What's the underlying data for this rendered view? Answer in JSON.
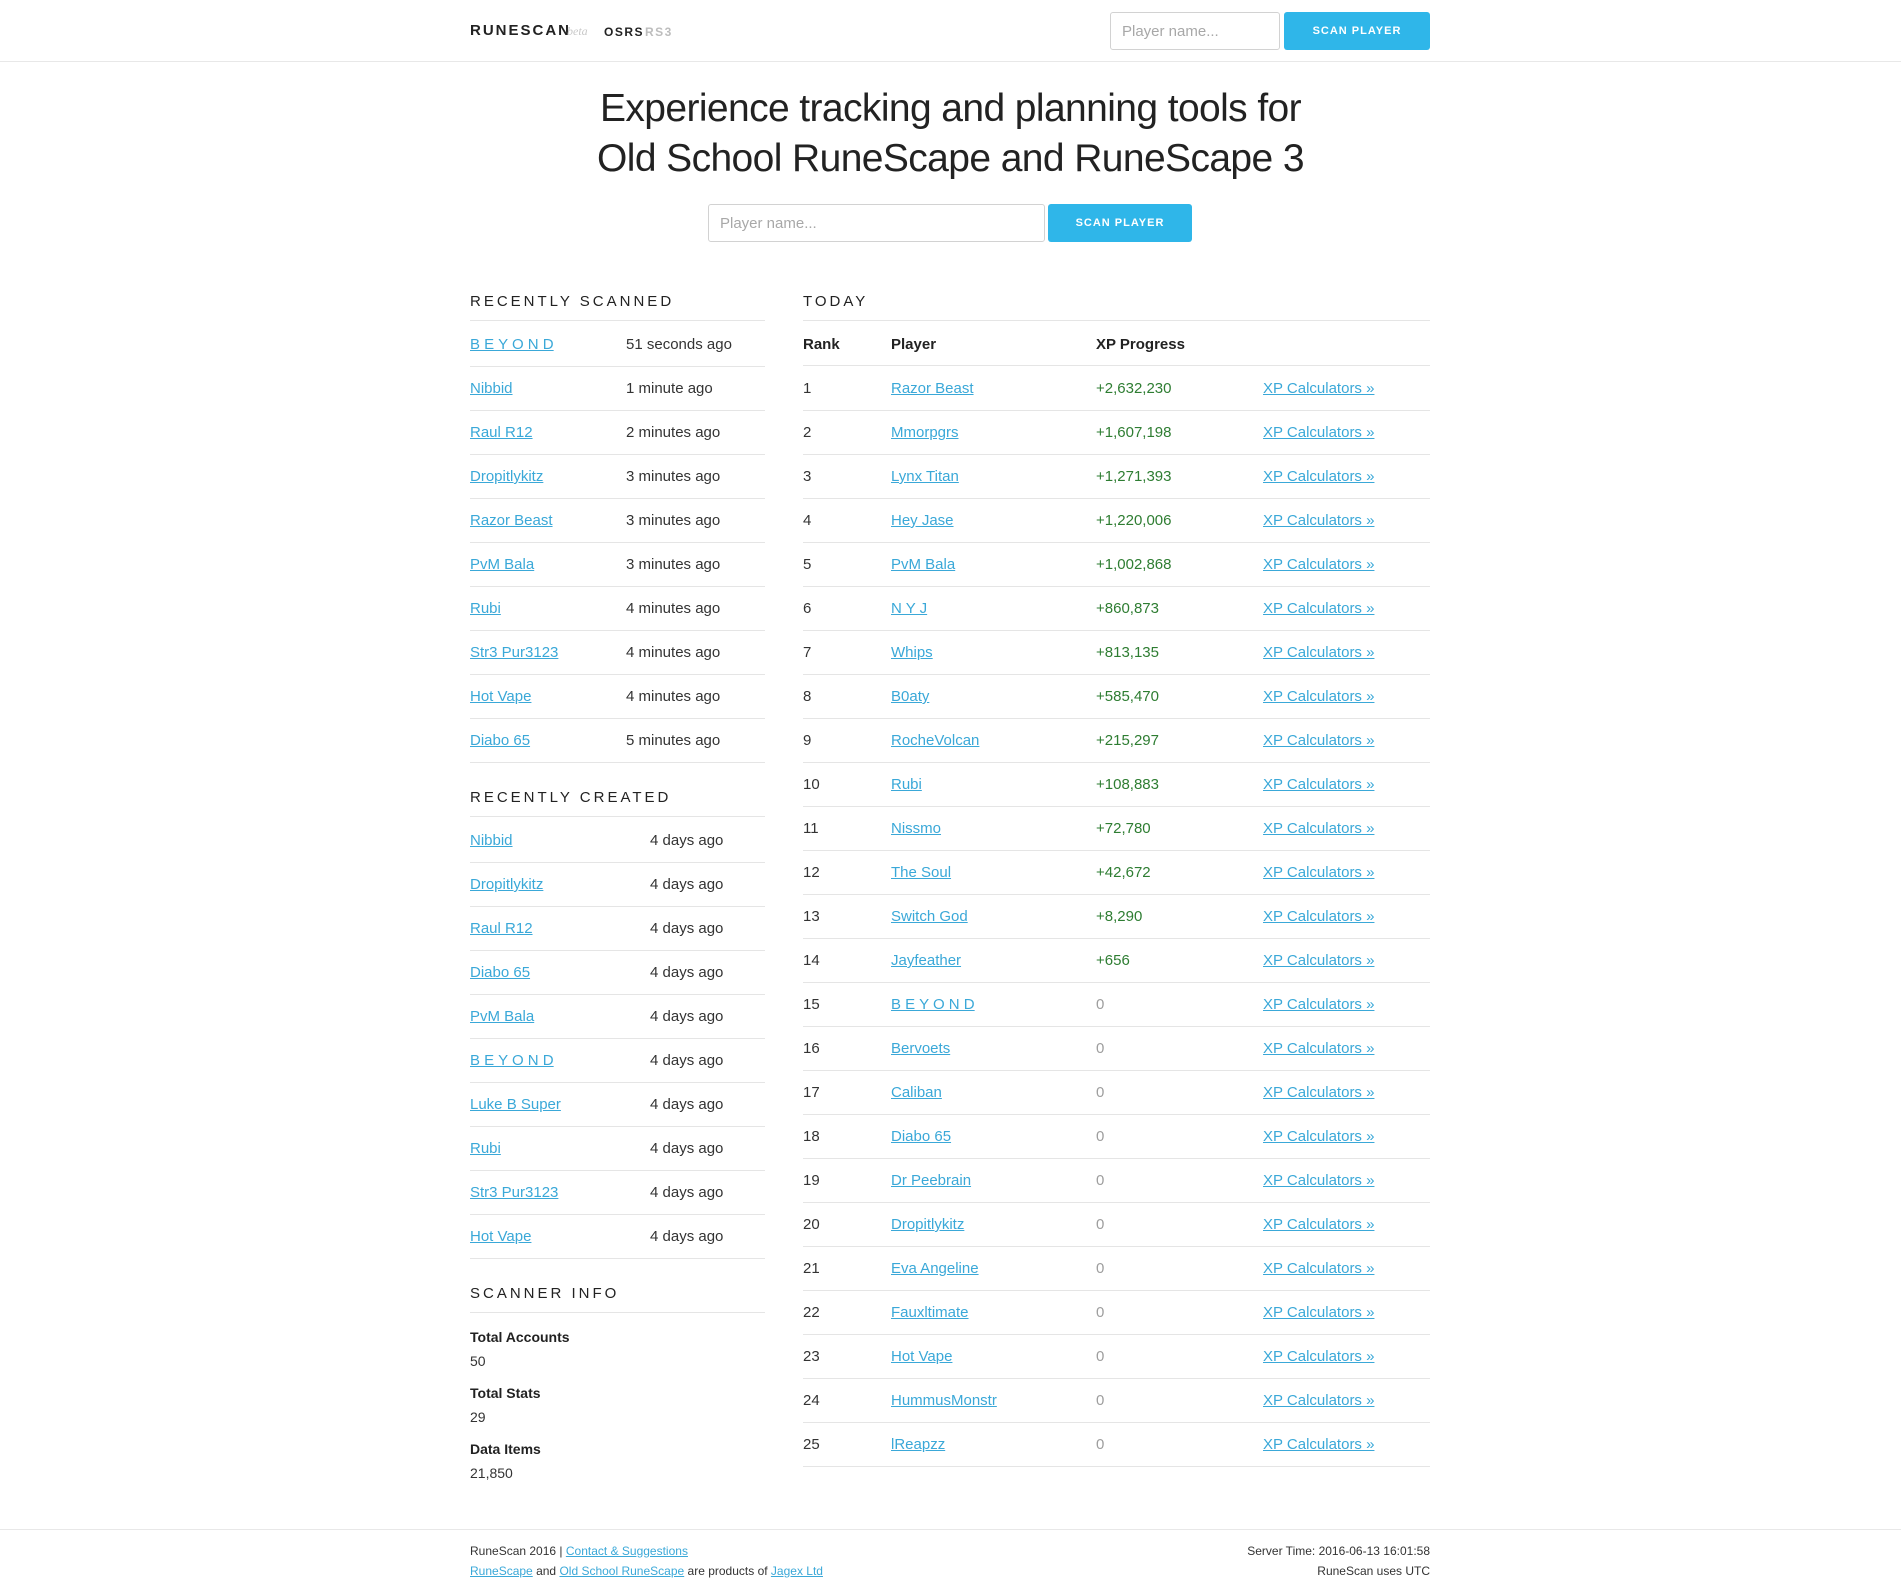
{
  "nav": {
    "brand": "RUNESCAN",
    "beta": "beta",
    "osrs": "OSRS",
    "rs3": "RS3",
    "search_placeholder": "Player name...",
    "scan_button": "SCAN PLAYER"
  },
  "hero": {
    "title_line1": "Experience tracking and planning tools for",
    "title_line2": "Old School RuneScape and RuneScape 3",
    "search_placeholder": "Player name...",
    "scan_button": "SCAN PLAYER"
  },
  "recently_scanned": {
    "heading": "RECENTLY SCANNED",
    "items": [
      {
        "name": "B E Y O N D",
        "time": "51 seconds ago"
      },
      {
        "name": "Nibbid",
        "time": "1 minute ago"
      },
      {
        "name": "Raul R12",
        "time": "2 minutes ago"
      },
      {
        "name": "Dropitlykitz",
        "time": "3 minutes ago"
      },
      {
        "name": "Razor Beast",
        "time": "3 minutes ago"
      },
      {
        "name": "PvM Bala",
        "time": "3 minutes ago"
      },
      {
        "name": "Rubi",
        "time": "4 minutes ago"
      },
      {
        "name": "Str3 Pur3123",
        "time": "4 minutes ago"
      },
      {
        "name": "Hot Vape",
        "time": "4 minutes ago"
      },
      {
        "name": "Diabo 65",
        "time": "5 minutes ago"
      }
    ]
  },
  "recently_created": {
    "heading": "RECENTLY CREATED",
    "items": [
      {
        "name": "Nibbid",
        "time": "4 days ago"
      },
      {
        "name": "Dropitlykitz",
        "time": "4 days ago"
      },
      {
        "name": "Raul R12",
        "time": "4 days ago"
      },
      {
        "name": "Diabo 65",
        "time": "4 days ago"
      },
      {
        "name": "PvM Bala",
        "time": "4 days ago"
      },
      {
        "name": "B E Y O N D",
        "time": "4 days ago"
      },
      {
        "name": "Luke B Super",
        "time": "4 days ago"
      },
      {
        "name": "Rubi",
        "time": "4 days ago"
      },
      {
        "name": "Str3 Pur3123",
        "time": "4 days ago"
      },
      {
        "name": "Hot Vape",
        "time": "4 days ago"
      }
    ]
  },
  "scanner_info": {
    "heading": "SCANNER INFO",
    "total_accounts_label": "Total Accounts",
    "total_accounts": "50",
    "total_stats_label": "Total Stats",
    "total_stats": "29",
    "data_items_label": "Data Items",
    "data_items": "21,850"
  },
  "today": {
    "heading": "TODAY",
    "columns": [
      "Rank",
      "Player",
      "XP Progress"
    ],
    "link_label": "XP Calculators »",
    "rows": [
      {
        "rank": "1",
        "player": "Razor Beast",
        "xp": "+2,632,230"
      },
      {
        "rank": "2",
        "player": "Mmorpgrs",
        "xp": "+1,607,198"
      },
      {
        "rank": "3",
        "player": "Lynx Titan",
        "xp": "+1,271,393"
      },
      {
        "rank": "4",
        "player": "Hey Jase",
        "xp": "+1,220,006"
      },
      {
        "rank": "5",
        "player": "PvM Bala",
        "xp": "+1,002,868"
      },
      {
        "rank": "6",
        "player": "N Y J",
        "xp": "+860,873"
      },
      {
        "rank": "7",
        "player": "Whips",
        "xp": "+813,135"
      },
      {
        "rank": "8",
        "player": "B0aty",
        "xp": "+585,470"
      },
      {
        "rank": "9",
        "player": "RocheVolcan",
        "xp": "+215,297"
      },
      {
        "rank": "10",
        "player": "Rubi",
        "xp": "+108,883"
      },
      {
        "rank": "11",
        "player": "Nissmo",
        "xp": "+72,780"
      },
      {
        "rank": "12",
        "player": "The Soul",
        "xp": "+42,672"
      },
      {
        "rank": "13",
        "player": "Switch God",
        "xp": "+8,290"
      },
      {
        "rank": "14",
        "player": "Jayfeather",
        "xp": "+656"
      },
      {
        "rank": "15",
        "player": "B E Y O N D",
        "xp": "0"
      },
      {
        "rank": "16",
        "player": "Bervoets",
        "xp": "0"
      },
      {
        "rank": "17",
        "player": "Caliban",
        "xp": "0"
      },
      {
        "rank": "18",
        "player": "Diabo 65",
        "xp": "0"
      },
      {
        "rank": "19",
        "player": "Dr Peebrain",
        "xp": "0"
      },
      {
        "rank": "20",
        "player": "Dropitlykitz",
        "xp": "0"
      },
      {
        "rank": "21",
        "player": "Eva Angeline",
        "xp": "0"
      },
      {
        "rank": "22",
        "player": "Fauxltimate",
        "xp": "0"
      },
      {
        "rank": "23",
        "player": "Hot Vape",
        "xp": "0"
      },
      {
        "rank": "24",
        "player": "HummusMonstr",
        "xp": "0"
      },
      {
        "rank": "25",
        "player": "lReapzz",
        "xp": "0"
      }
    ]
  },
  "footer": {
    "copyright": "RuneScan 2016 |",
    "contact_link": "Contact & Suggestions",
    "runescape_link": "RuneScape",
    "and_text": "and",
    "osrs_link": "Old School RuneScape",
    "products_text": "are products of",
    "jagex_link": "Jagex Ltd",
    "server_time": "Server Time: 2016-06-13 16:01:58",
    "utc_note": "RuneScan uses UTC"
  },
  "colors": {
    "accent": "#2fb6e9",
    "link": "#3aa8d8",
    "xp_positive": "#2e7d32",
    "xp_zero": "#9e9e9e"
  }
}
